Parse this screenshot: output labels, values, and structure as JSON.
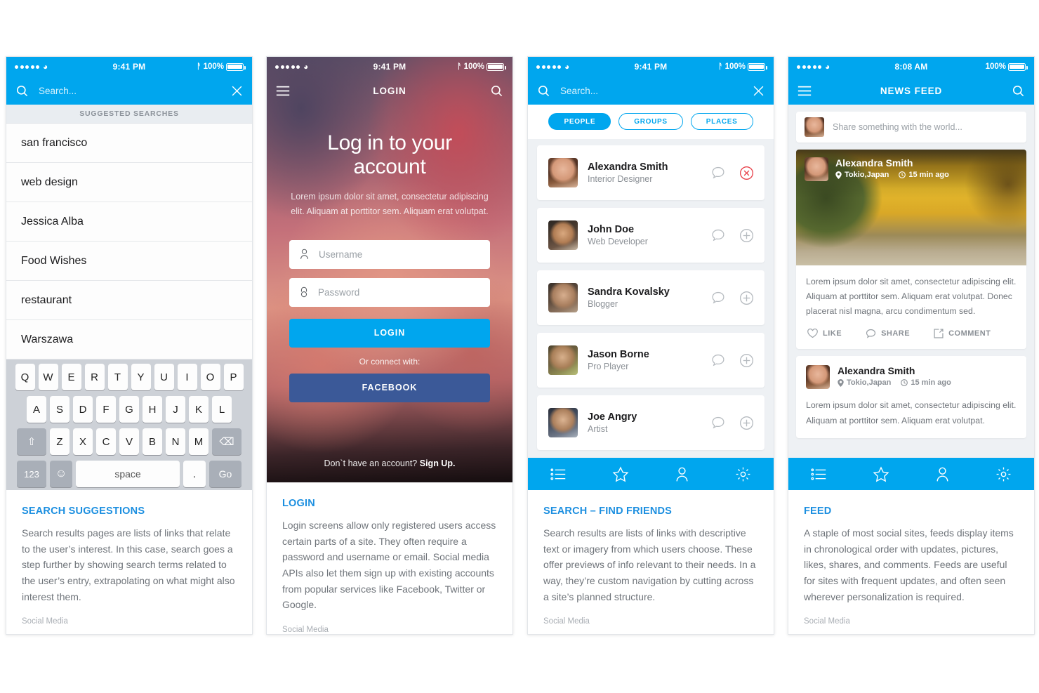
{
  "colors": {
    "accent": "#00a6ee",
    "facebook": "#3b5998",
    "caption_title": "#1c8fe0",
    "danger": "#e8414a"
  },
  "panel1": {
    "status": {
      "time": "9:41 PM",
      "battery": "100%",
      "bluetooth": "bluetooth-icon"
    },
    "search_placeholder": "Search...",
    "section_header": "SUGGESTED SEARCHES",
    "suggestions": [
      "san francisco",
      "web design",
      "Jessica Alba",
      "Food Wishes",
      "restaurant",
      "Warszawa"
    ],
    "keyboard": {
      "row1": [
        "Q",
        "W",
        "E",
        "R",
        "T",
        "Y",
        "U",
        "I",
        "O",
        "P"
      ],
      "row2": [
        "A",
        "S",
        "D",
        "F",
        "G",
        "H",
        "J",
        "K",
        "L"
      ],
      "row3": [
        "Z",
        "X",
        "C",
        "V",
        "B",
        "N",
        "M"
      ],
      "shift": "⇧",
      "backspace": "⌫",
      "numbers": "123",
      "emoji": "☺",
      "space": "space",
      "period": ".",
      "go": "Go"
    },
    "caption": {
      "title": "SEARCH SUGGESTIONS",
      "body": "Search results pages are lists of links that relate to the user’s interest. In this case, search goes a step further by showing search terms related to the user’s entry, extrapolating on what might also interest them.",
      "tag": "Social Media"
    }
  },
  "panel2": {
    "status": {
      "time": "9:41 PM",
      "battery": "100%"
    },
    "nav_title": "LOGIN",
    "heading": "Log in to your account",
    "subtext": "Lorem ipsum dolor sit amet, consectetur adipiscing elit. Aliquam at porttitor sem. Aliquam erat volutpat.",
    "username_placeholder": "Username",
    "password_placeholder": "Password",
    "login_button": "LOGIN",
    "connect_label": "Or connect with:",
    "facebook_button": "FACEBOOK",
    "signup_prompt": "Don`t have an account?",
    "signup_link": "Sign Up.",
    "caption": {
      "title": "LOGIN",
      "body": "Login screens allow only registered users access certain parts of a site. They often require a password and username or email. Social media APIs also let them sign up with existing accounts from popular services like Facebook, Twitter or Google.",
      "tag": "Social Media"
    }
  },
  "panel3": {
    "status": {
      "time": "9:41 PM",
      "battery": "100%"
    },
    "search_placeholder": "Search...",
    "tabs": [
      {
        "label": "PEOPLE",
        "active": true
      },
      {
        "label": "GROUPS",
        "active": false
      },
      {
        "label": "PLACES",
        "active": false
      }
    ],
    "friends": [
      {
        "name": "Alexandra Smith",
        "role": "Interior Designer",
        "action": "remove"
      },
      {
        "name": "John Doe",
        "role": "Web Developer",
        "action": "add"
      },
      {
        "name": "Sandra Kovalsky",
        "role": "Blogger",
        "action": "add"
      },
      {
        "name": "Jason Borne",
        "role": "Pro Player",
        "action": "add"
      },
      {
        "name": "Joe Angry",
        "role": "Artist",
        "action": "add"
      }
    ],
    "tabbar": [
      "list-icon",
      "star-icon",
      "person-icon",
      "gear-icon"
    ],
    "caption": {
      "title": "SEARCH – FIND FRIENDS",
      "body": "Search results are lists of links with descriptive text or imagery from which users choose. These offer previews of info relevant to their needs. In a way, they’re custom navigation by cutting across a site’s planned structure.",
      "tag": "Social Media"
    }
  },
  "panel4": {
    "status": {
      "time": "8:08 AM",
      "battery": "100%"
    },
    "nav_title": "NEWS FEED",
    "composer_placeholder": "Share something with the world...",
    "posts": [
      {
        "author": "Alexandra Smith",
        "location": "Tokio,Japan",
        "time": "15 min ago",
        "text": "Lorem ipsum dolor sit amet, consectetur adipiscing elit. Aliquam at porttitor sem. Aliquam erat volutpat. Donec placerat nisl magna, arcu condimentum sed.",
        "has_photo": true
      },
      {
        "author": "Alexandra Smith",
        "location": "Tokio,Japan",
        "time": "15 min ago",
        "text": "Lorem ipsum dolor sit amet, consectetur adipiscing elit. Aliquam at porttitor sem. Aliquam erat volutpat.",
        "has_photo": false
      }
    ],
    "actions": [
      {
        "label": "LIKE",
        "icon": "heart-icon"
      },
      {
        "label": "SHARE",
        "icon": "speech-bubble-icon"
      },
      {
        "label": "COMMENT",
        "icon": "external-link-icon"
      }
    ],
    "tabbar": [
      "list-icon",
      "star-icon",
      "person-icon",
      "gear-icon"
    ],
    "caption": {
      "title": "FEED",
      "body": "A staple of most social sites, feeds display items in chronological order with updates, pictures, likes, shares, and comments. Feeds are useful for sites with frequent updates, and often seen wherever personalization is required.",
      "tag": "Social Media"
    }
  }
}
